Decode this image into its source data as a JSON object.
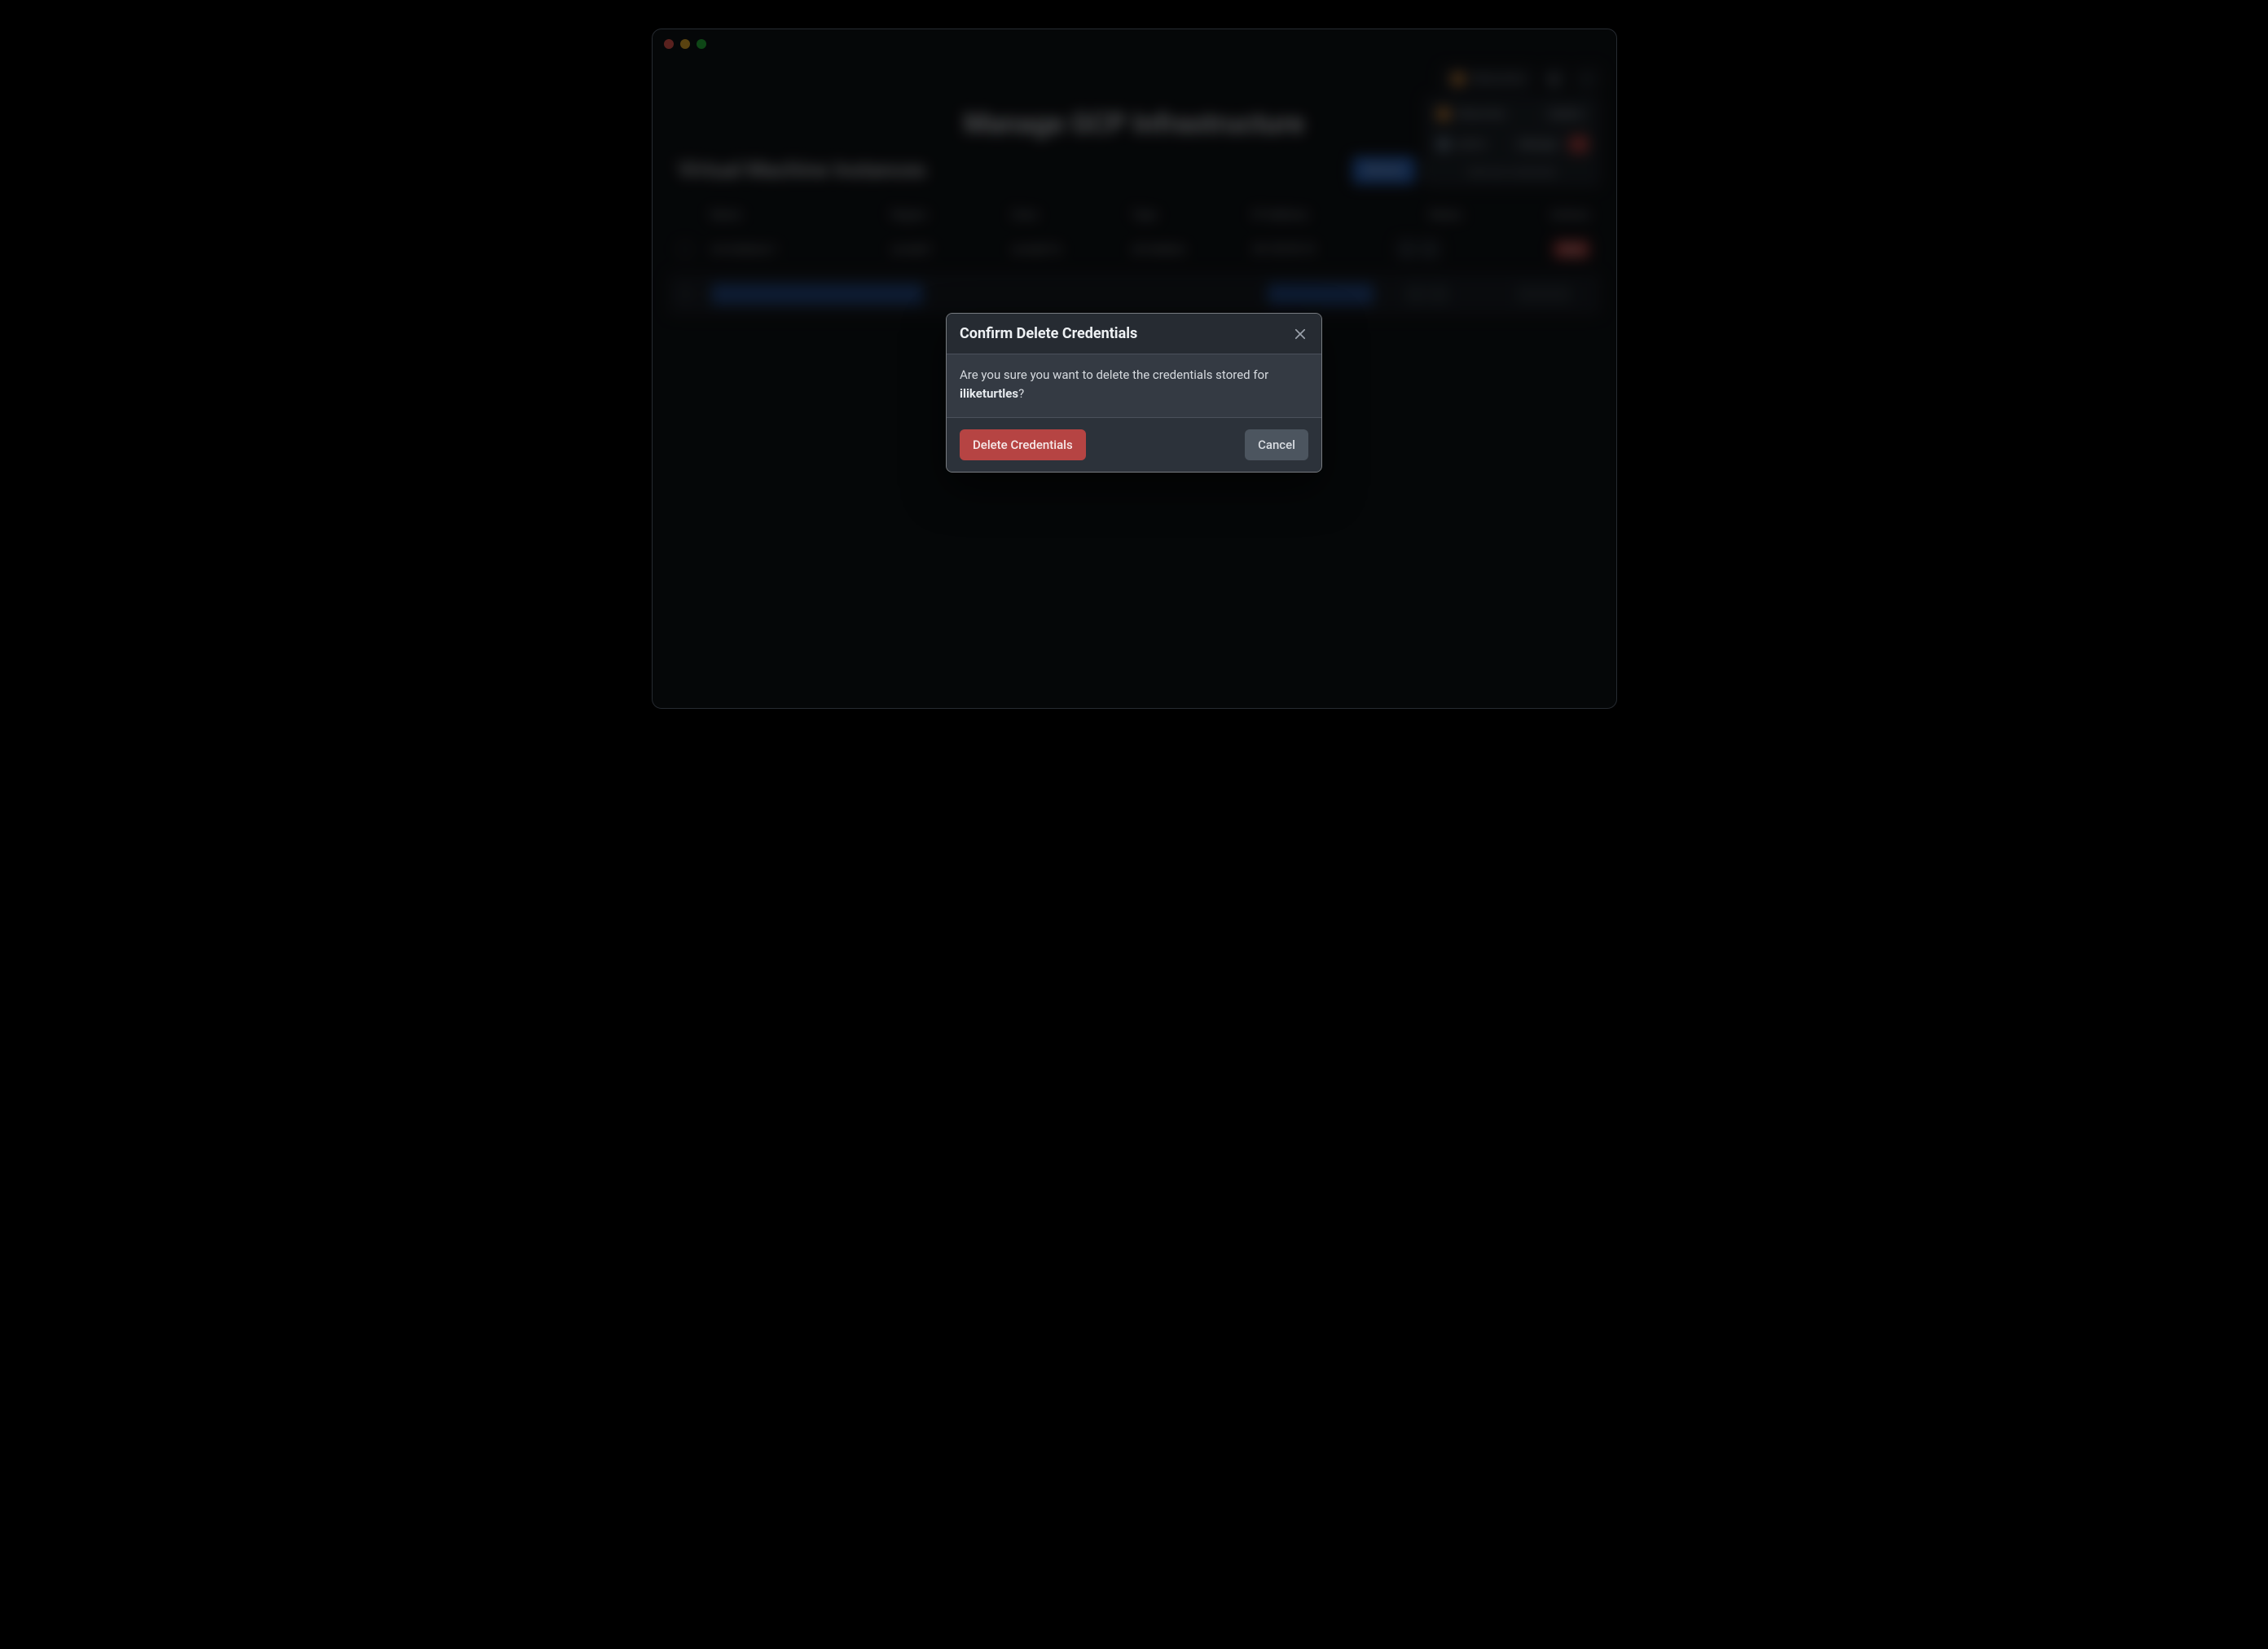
{
  "window": {
    "title_page": "Manage GCP Infrastructure"
  },
  "header": {
    "user_label": "iliketurtles"
  },
  "user_menu": {
    "rows": [
      {
        "name": "iliketurtles",
        "action": "Switch"
      },
      {
        "name": "admin",
        "action": "Manage"
      }
    ],
    "add_label": "Add new credentials"
  },
  "sub_header": {
    "title": "Virtual Machine Instances",
    "refresh": "Refresh",
    "stopall": "Stop",
    "create": "Create VM"
  },
  "table": {
    "cols": [
      "",
      "Name",
      "Region",
      "Zone",
      "Type",
      "IP Address",
      "Status",
      "Actions"
    ],
    "rows": [
      {
        "name": "vm-instance-1",
        "region": "us-east1",
        "zone": "us-east1-b",
        "type": "e2-medium",
        "ip": "34.120.55.10",
        "status": "Running",
        "action": "Stop"
      },
      {
        "name": "",
        "region": "",
        "zone": "",
        "type": "",
        "ip": "",
        "status": "",
        "action": ""
      }
    ]
  },
  "modal": {
    "title": "Confirm Delete Credentials",
    "body_prefix": "Are you sure you want to delete the credentials stored for ",
    "target": "iliketurtles",
    "body_suffix": "?",
    "delete_label": "Delete Credentials",
    "cancel_label": "Cancel"
  }
}
